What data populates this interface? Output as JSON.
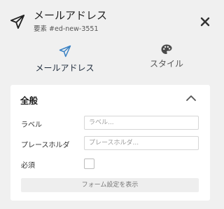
{
  "header": {
    "title": "メールアドレス",
    "subtitle": "要素 #ed-new-3551",
    "icon": "paper-plane-icon"
  },
  "tabs": [
    {
      "label": "メールアドレス",
      "icon": "paper-plane-icon",
      "active": true,
      "color": "#3b82c4"
    },
    {
      "label": "スタイル",
      "icon": "palette-icon",
      "active": false,
      "color": "#555555"
    }
  ],
  "section": {
    "title": "全般",
    "expanded": true,
    "fields": [
      {
        "label": "ラベル",
        "value": "",
        "placeholder": "ラベル..."
      },
      {
        "label": "プレースホルダ",
        "value": "",
        "placeholder": "プレースホルダ..."
      }
    ],
    "required": {
      "label": "必須",
      "checked": false
    },
    "show_form_settings_label": "フォーム設定を表示"
  }
}
